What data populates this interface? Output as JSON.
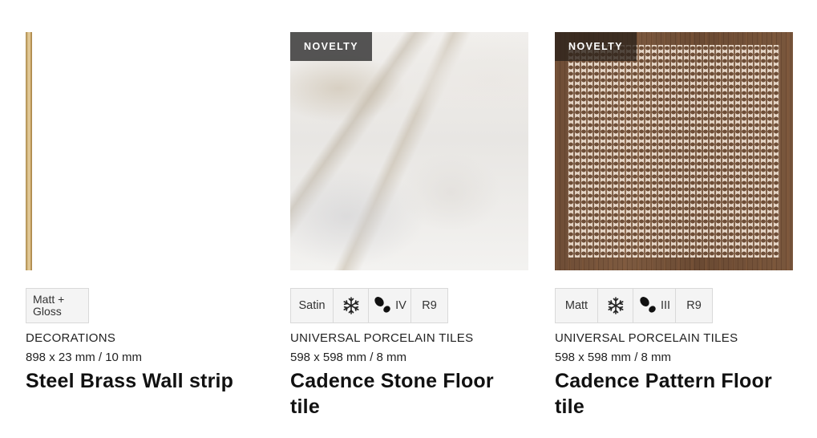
{
  "products": [
    {
      "badge": "",
      "attributes": {
        "finish": "Matt +\nGloss"
      },
      "category": "DECORATIONS",
      "dimensions": "898 x 23 mm / 10 mm",
      "name": "Steel Brass Wall strip"
    },
    {
      "badge": "NOVELTY",
      "attributes": {
        "finish": "Satin",
        "frost_icon": "snowflake-icon",
        "abrasion_icon": "footprint-icon",
        "abrasion": "IV",
        "slip": "R9"
      },
      "category": "UNIVERSAL PORCELAIN TILES",
      "dimensions": "598 x 598 mm / 8 mm",
      "name": "Cadence Stone Floor tile"
    },
    {
      "badge": "NOVELTY",
      "attributes": {
        "finish": "Matt",
        "frost_icon": "snowflake-icon",
        "abrasion_icon": "footprint-icon",
        "abrasion": "III",
        "slip": "R9"
      },
      "category": "UNIVERSAL PORCELAIN TILES",
      "dimensions": "598 x 598 mm / 8 mm",
      "name": "Cadence Pattern Floor tile"
    }
  ],
  "colors": {
    "badge_bg": "#3a3a3a",
    "attr_bg": "#f4f4f4",
    "attr_border": "#d9d9d9",
    "text": "#111111"
  }
}
